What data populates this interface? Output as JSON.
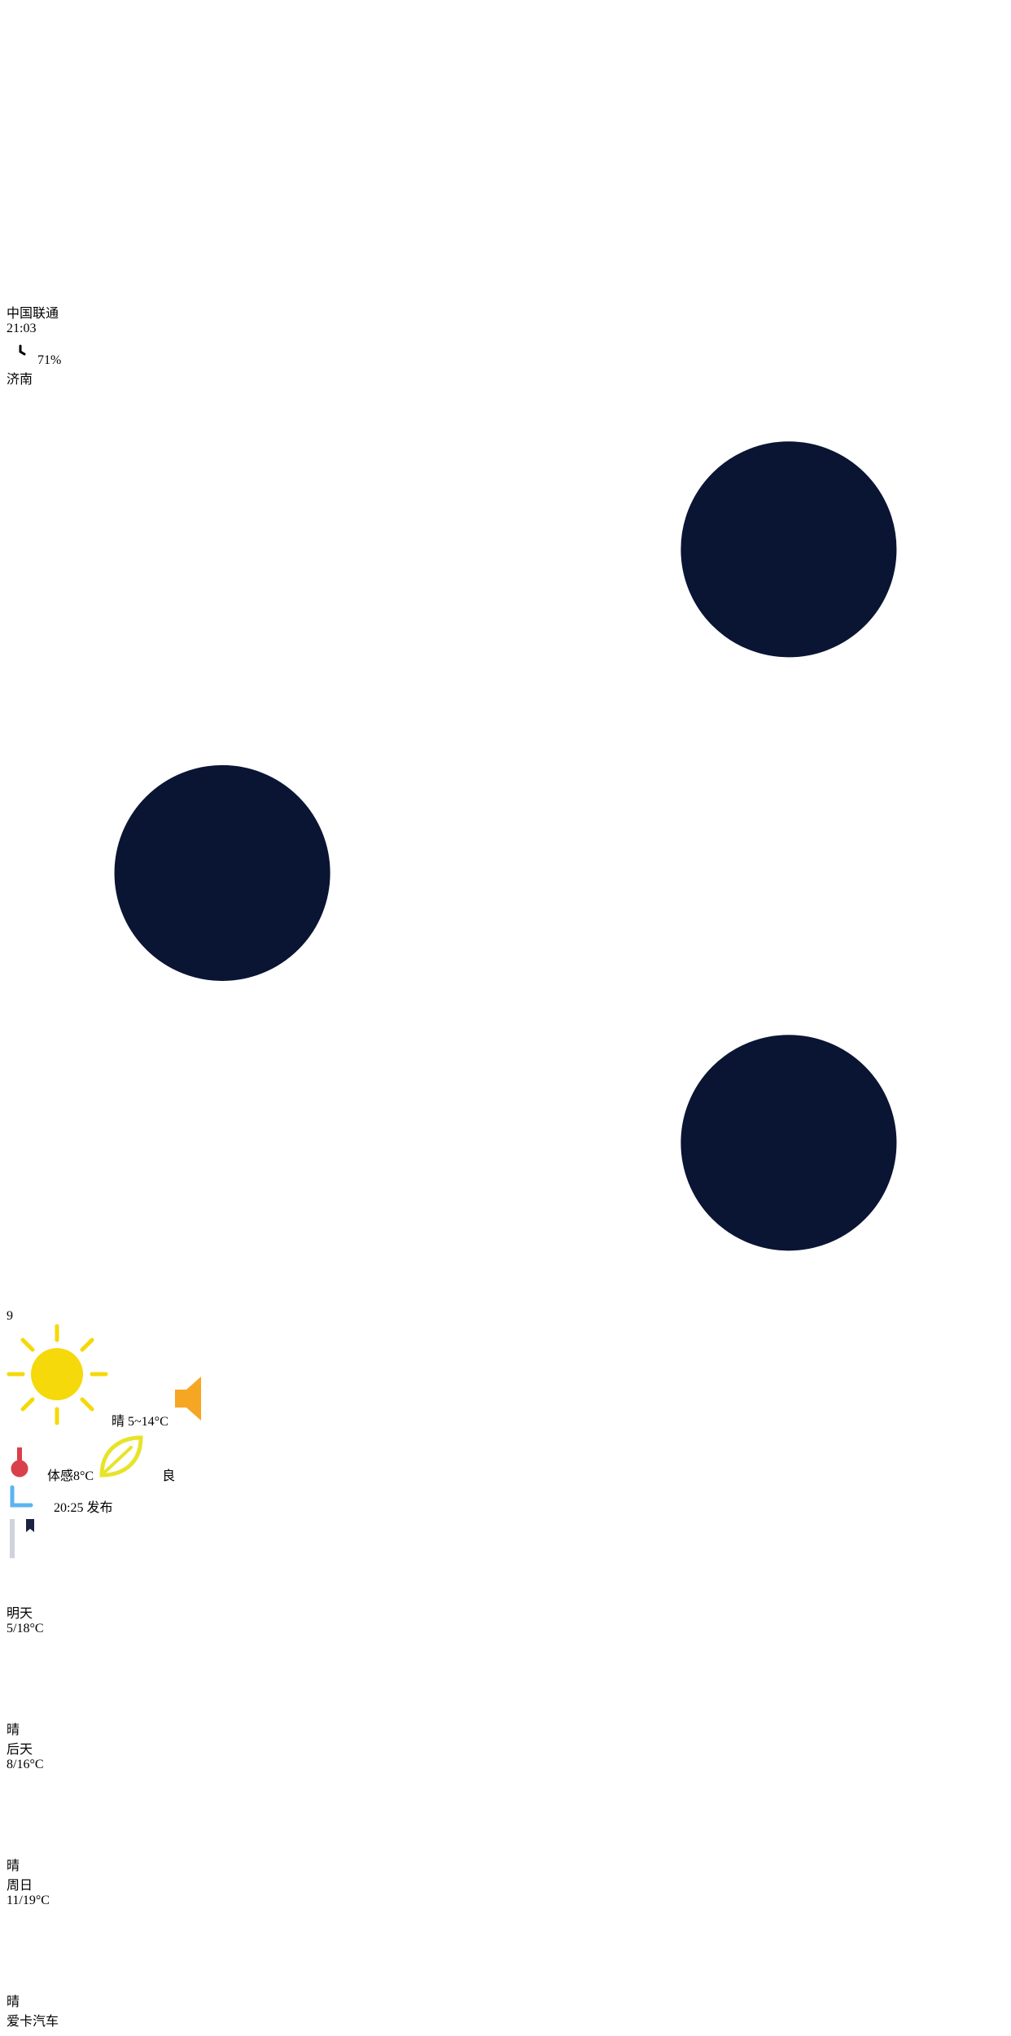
{
  "status_bar": {
    "carrier": "中国联通",
    "time": "21:03",
    "battery": "71%",
    "battery_level": 0.71,
    "signal_dots": 5,
    "signal_filled": 4
  },
  "header": {
    "city": "济南",
    "page_count": 6,
    "active_page": 3
  },
  "current": {
    "temperature": "9",
    "condition": "晴",
    "range": "5~14°C",
    "feels_like": "体感8°C",
    "air_quality": "良",
    "published": "20:25",
    "published_suffix": "发布"
  },
  "forecast": [
    {
      "day": "明天",
      "range": "5/18°C",
      "condition": "晴"
    },
    {
      "day": "后天",
      "range": "8/16°C",
      "condition": "晴"
    },
    {
      "day": "周日",
      "range": "11/19°C",
      "condition": "晴"
    }
  ],
  "icons": {
    "menu": "menu-icon",
    "share": "share-icon",
    "sun": "sun-icon",
    "speaker": "speaker-icon",
    "thermometer": "thermometer-icon",
    "leaf": "leaf-icon",
    "clock": "clock-icon",
    "book": "book-icon",
    "cloud": "cloud-icon",
    "alarm": "alarm-icon",
    "wifi": "wifi-icon"
  },
  "colors": {
    "sun": "#f5d90a",
    "speaker": "#f5a623",
    "badge": "#e5232a",
    "leaf": "#e8e32a",
    "thermometer_bulb": "#d9414a",
    "clock": "#5bb4f0"
  },
  "watermark": "爱卡汽车"
}
